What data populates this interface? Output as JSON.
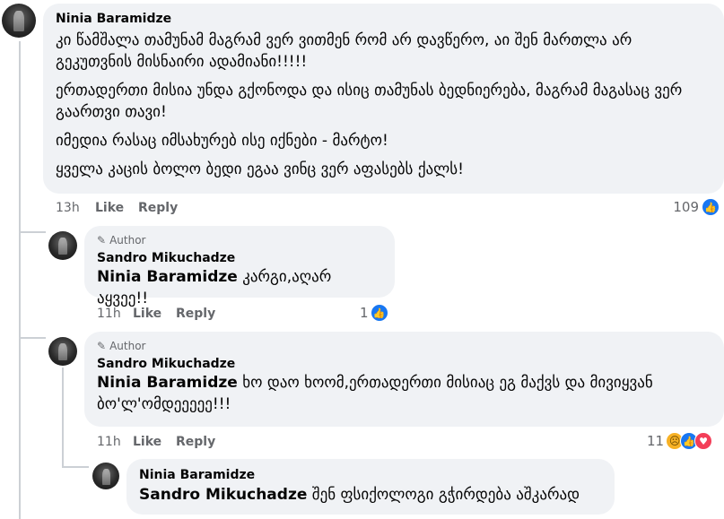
{
  "comments": [
    {
      "author": "Ninia Baramidze",
      "paragraphs": [
        "კი წამშალა თამუნამ მაგრამ ვერ ვითმენ რომ არ დავწერო, აი შენ მართლა არ გეკუთვნის მისნაირი ადამიანი!!!!!",
        "ერთადერთი მისია უნდა გქონოდა და ისიც თამუნას ბედნიერება, მაგრამ მაგასაც ვერ გაართვი თავი!",
        "იმედია რასაც იმსახურებ ისე იქნები - მარტო!",
        "ყველა კაცის ბოლო ბედი ეგაა ვინც ვერ აფასებს ქალს!"
      ],
      "time": "13h",
      "like": "Like",
      "reply": "Reply",
      "reactions": "109"
    },
    {
      "badge": "Author",
      "author": "Sandro Mikuchadze",
      "mention": "Ninia Baramidze",
      "text": " კარგი,აღარ აყვეე!!",
      "time": "11h",
      "like": "Like",
      "reply": "Reply",
      "reactions": "1"
    },
    {
      "badge": "Author",
      "author": "Sandro Mikuchadze",
      "mention": "Ninia Baramidze",
      "text": " ხო დაო ხოომ,ერთადერთი მისიაც ეგ მაქვს და მივიყვან ბო'ლ'ომდეეეეე!!!",
      "time": "11h",
      "like": "Like",
      "reply": "Reply",
      "reactions": "11"
    },
    {
      "author": "Ninia Baramidze",
      "mention": "Sandro Mikuchadze",
      "text": " შენ ფსიქოლოგი გჭირდება აშკარად"
    }
  ],
  "icons": {
    "like": "like-reaction-icon",
    "sad": "sad-reaction-icon",
    "love": "love-reaction-icon",
    "author_badge": "pen-icon"
  }
}
